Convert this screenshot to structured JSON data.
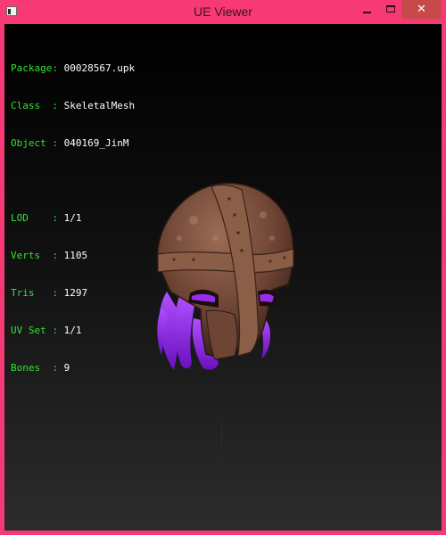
{
  "window": {
    "title": "UE Viewer",
    "controls": {
      "minimize": "minimize",
      "maximize": "maximize",
      "close": "✕"
    }
  },
  "info": {
    "package": {
      "label": "Package:",
      "value": "00028567.upk"
    },
    "class": {
      "label": "Class  :",
      "value": "SkeletalMesh"
    },
    "object": {
      "label": "Object :",
      "value": "040169_JinM"
    },
    "lod": {
      "label": "LOD    :",
      "value": "1/1"
    },
    "verts": {
      "label": "Verts  :",
      "value": "1105"
    },
    "tris": {
      "label": "Tris   :",
      "value": "1297"
    },
    "uvset": {
      "label": "UV Set :",
      "value": "1/1"
    },
    "bones": {
      "label": "Bones  :",
      "value": "9"
    }
  },
  "colors": {
    "border": "#f73a75",
    "info_label": "#35e035",
    "info_value": "#ffffff",
    "axis": "#1a1aa8",
    "helmet": "#7a4e3a",
    "hair": "#8a22e0"
  },
  "icons": [
    "app-icon",
    "minimize-icon",
    "maximize-icon",
    "close-icon"
  ]
}
